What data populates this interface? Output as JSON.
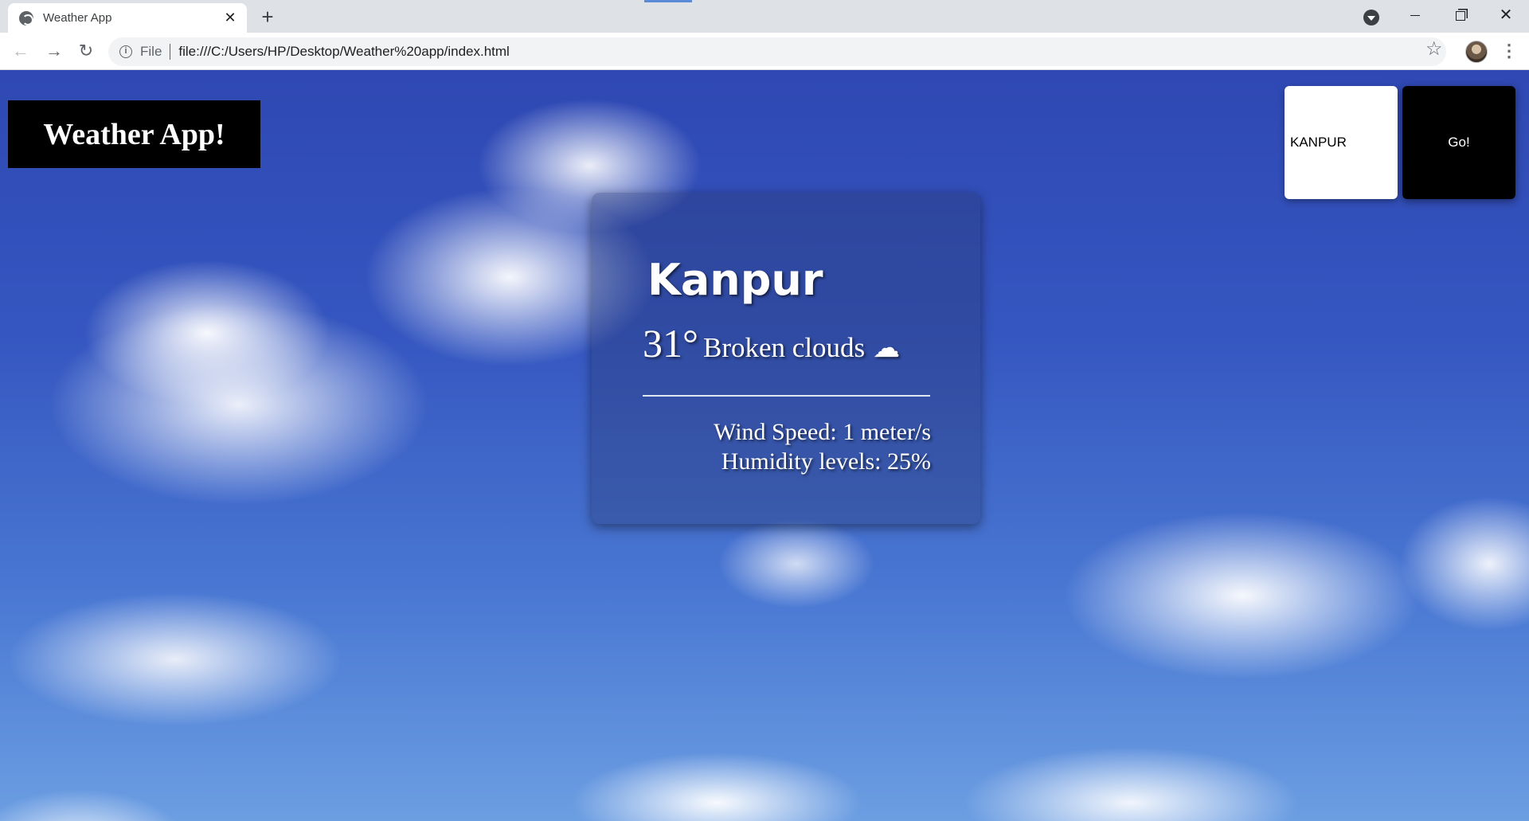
{
  "browser": {
    "tab_title": "Weather App",
    "tab_close": "✕",
    "new_tab": "+",
    "url_scheme": "File",
    "url": "file:///C:/Users/HP/Desktop/Weather%20app/index.html",
    "back_glyph": "←",
    "forward_glyph": "→",
    "reload_glyph": "↻",
    "star_glyph": "☆",
    "menu_glyph": "⋮",
    "close_glyph": "✕",
    "info_glyph": "i"
  },
  "app": {
    "title": "Weather App!",
    "search_value": "KANPUR",
    "go_label": "Go!"
  },
  "weather": {
    "city": "Kanpur",
    "temperature": "31°",
    "condition": "Broken clouds",
    "icon": "☁",
    "icon_name": "broken-clouds-icon",
    "wind": "Wind Speed: 1 meter/s",
    "humidity": "Humidity levels: 25%"
  },
  "colors": {
    "sky": "#3556c0",
    "brand_bg": "#000000",
    "go_bg": "#000000",
    "search_bg": "#ffffff"
  }
}
